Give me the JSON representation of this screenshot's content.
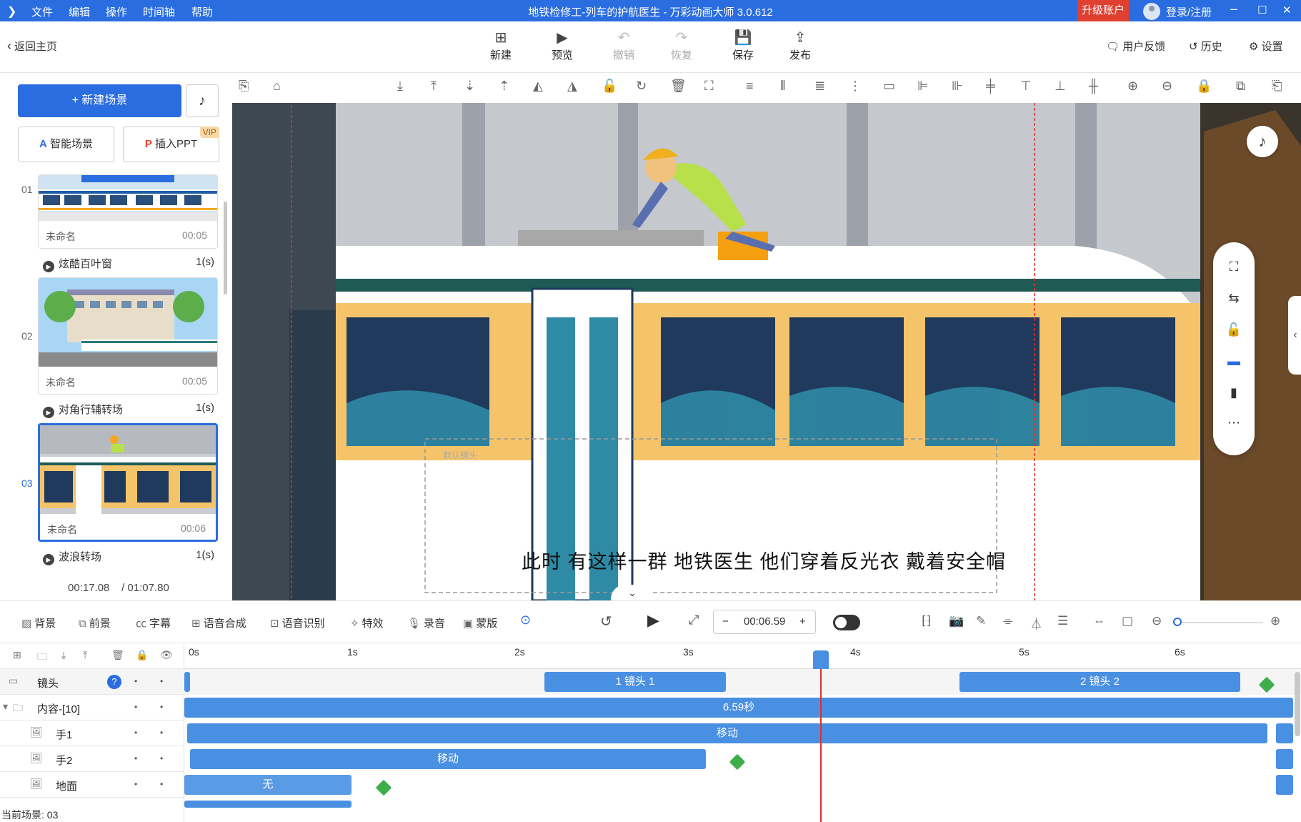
{
  "titlebar": {
    "menu": [
      "文件",
      "编辑",
      "操作",
      "时间轴",
      "帮助"
    ],
    "title": "地铁检修工-列车的护航医生 - 万彩动画大师 3.0.612",
    "upgrade": "升级账户",
    "login": "登录/注册",
    "win_min": "–",
    "win_max": "☐",
    "win_close": "✕"
  },
  "toolbar": {
    "back": "返回主页",
    "buttons": [
      {
        "label": "新建",
        "icon": "plus-square-icon"
      },
      {
        "label": "预览",
        "icon": "play-icon"
      },
      {
        "label": "撤销",
        "icon": "undo-icon"
      },
      {
        "label": "恢复",
        "icon": "redo-icon"
      },
      {
        "label": "保存",
        "icon": "save-icon"
      },
      {
        "label": "发布",
        "icon": "publish-icon"
      }
    ],
    "right": [
      "用户反馈",
      "历史",
      "设置"
    ]
  },
  "left": {
    "new_scene": "+ 新建场景",
    "smart_scene": "智能场景",
    "insert_ppt": "插入PPT",
    "vip": "VIP",
    "scenes": [
      {
        "num": "01",
        "name": "未命名",
        "duration": "00:05",
        "transition": "炫酷百叶窗",
        "trans_time": "1(s)"
      },
      {
        "num": "02",
        "name": "未命名",
        "duration": "00:05",
        "transition": "对角行辅转场",
        "trans_time": "1(s)"
      },
      {
        "num": "03",
        "name": "未命名",
        "duration": "00:06",
        "transition": "波浪转场",
        "trans_time": "1(s)"
      }
    ],
    "current_time": "00:17.08",
    "total_time": "/ 01:07.80"
  },
  "stage": {
    "subtitle": "此时 有这样一群  地铁医生  他们穿着反光衣  戴着安全帽",
    "camera_label": "默认镜头"
  },
  "bottom_toolbar": {
    "items": [
      "背景",
      "前景",
      "字幕",
      "语音合成",
      "语音识别",
      "特效",
      "录音",
      "蒙版"
    ],
    "time": "00:06.59",
    "minus": "−",
    "plus": "+"
  },
  "timeline": {
    "ticks": [
      "0s",
      "1s",
      "2s",
      "3s",
      "4s",
      "5s",
      "6s"
    ],
    "tracks": [
      {
        "label": "镜头"
      },
      {
        "label": "内容-[10]"
      },
      {
        "label": "手1"
      },
      {
        "label": "手2"
      },
      {
        "label": "地面"
      }
    ],
    "bars": {
      "cam1": "1 镜头 1",
      "cam2": "2 镜头 2",
      "content": "6.59秒",
      "hand1": "移动",
      "hand2": "移动",
      "ground": "无"
    },
    "playhead_seconds": 3.8
  },
  "status": "当前场景: 03",
  "colors": {
    "accent": "#2a6de0",
    "bar": "#4a90e2",
    "playhead": "#e03030",
    "upgrade": "#e0402f"
  }
}
